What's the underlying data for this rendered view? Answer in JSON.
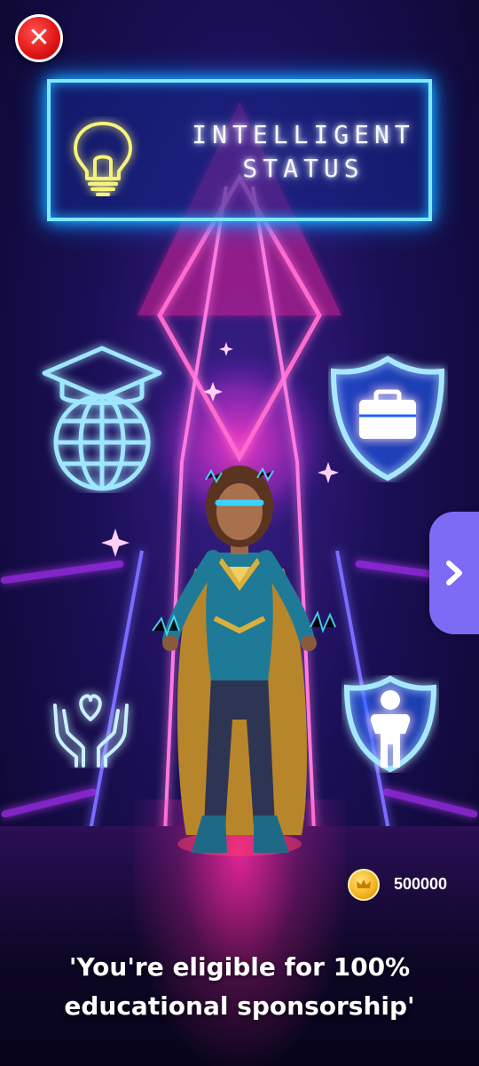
{
  "header": {
    "close_label": "✕",
    "title_line1": "INTELLIGENT",
    "title_line2": "STATUS"
  },
  "icons": {
    "title_icon": "lightbulb-icon",
    "left_top": "graduation-globe-icon",
    "right_top": "briefcase-shield-icon",
    "left_bottom": "caring-hands-heart-icon",
    "right_bottom": "person-shield-icon",
    "next": "chevron-right-icon"
  },
  "character": {
    "name_icon": "superhero-character"
  },
  "wallet": {
    "coin_icon": "crown-coin-icon",
    "amount": "500000"
  },
  "message": {
    "line1": "'You're eligible for 100%",
    "line2": "educational sponsorship'"
  },
  "colors": {
    "neon_cyan": "#19b6ff",
    "neon_pink": "#ff2fb0",
    "neon_purple": "#b030ff",
    "close_red": "#e01515",
    "next_button": "#7c6cf5",
    "coin_gold": "#f4b21f"
  }
}
